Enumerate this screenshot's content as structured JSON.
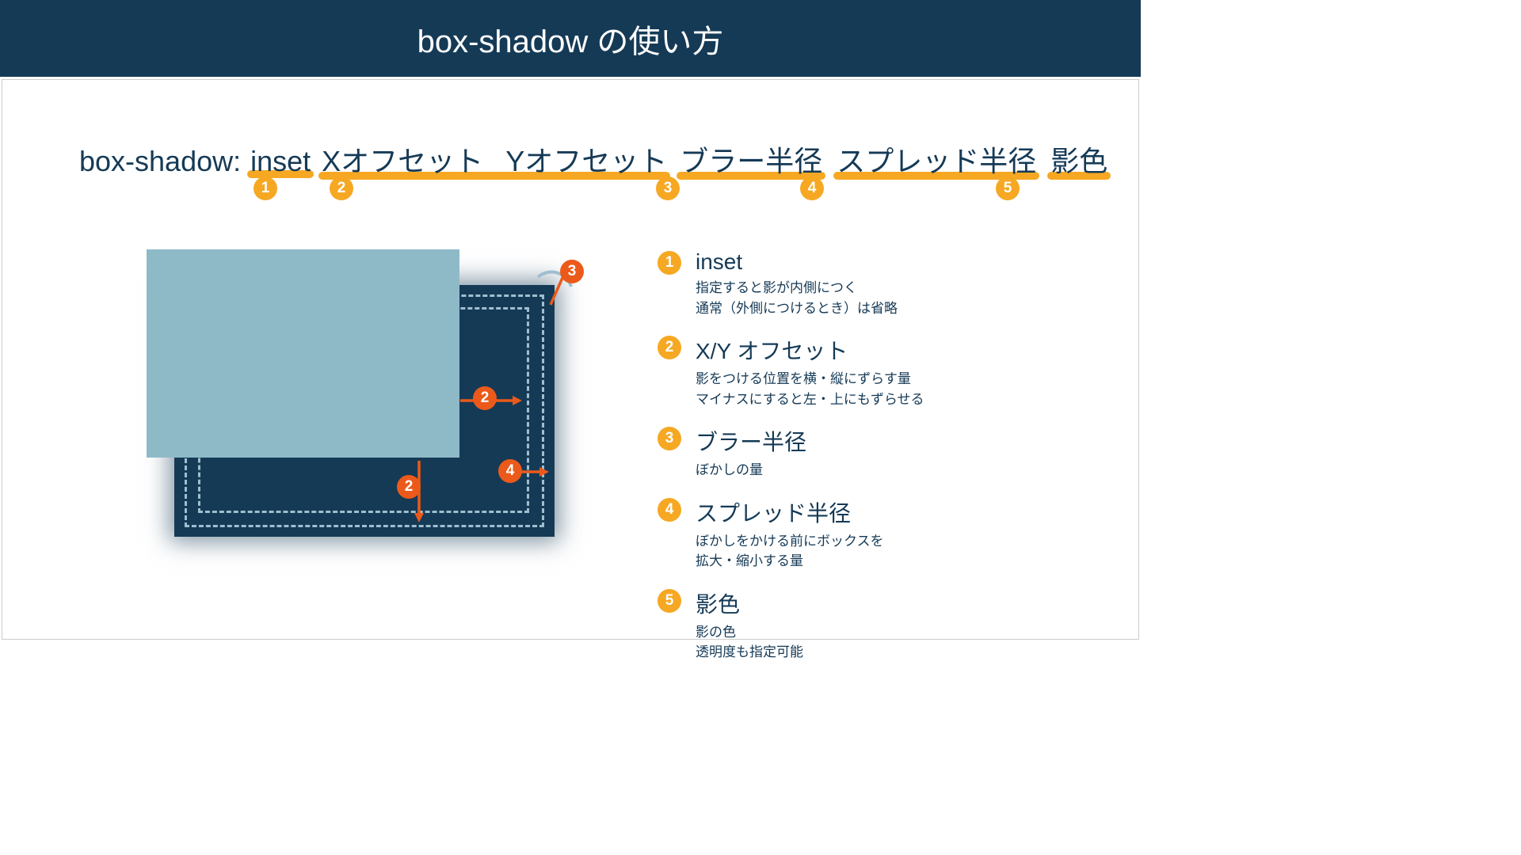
{
  "title": "box-shadow の使い方",
  "syntax": {
    "label": "box-shadow:",
    "tokens": {
      "inset": "inset",
      "xoffset": "Xオフセット",
      "yoffset": "Yオフセット",
      "blur": "ブラー半径",
      "spread": "スプレッド半径",
      "color": "影色"
    },
    "nums": {
      "n1": "1",
      "n2": "2",
      "n3": "3",
      "n4": "4",
      "n5": "5"
    }
  },
  "legend": [
    {
      "num": "1",
      "title": "inset",
      "desc_a": "指定すると影が内側につく",
      "desc_b": "通常（外側につけるとき）は省略"
    },
    {
      "num": "2",
      "title": "X/Y オフセット",
      "desc_a": "影をつける位置を横・縦にずらす量",
      "desc_b": "マイナスにすると左・上にもずらせる"
    },
    {
      "num": "3",
      "title": "ブラー半径",
      "desc_a": "ぼかしの量",
      "desc_b": ""
    },
    {
      "num": "4",
      "title": "スプレッド半径",
      "desc_a": "ぼかしをかける前にボックスを",
      "desc_b": "拡大・縮小する量"
    },
    {
      "num": "5",
      "title": "影色",
      "desc_a": "影の色",
      "desc_b": "透明度も指定可能"
    }
  ],
  "diagram_labels": {
    "n2a": "2",
    "n2b": "2",
    "n3": "3",
    "n4": "4"
  }
}
